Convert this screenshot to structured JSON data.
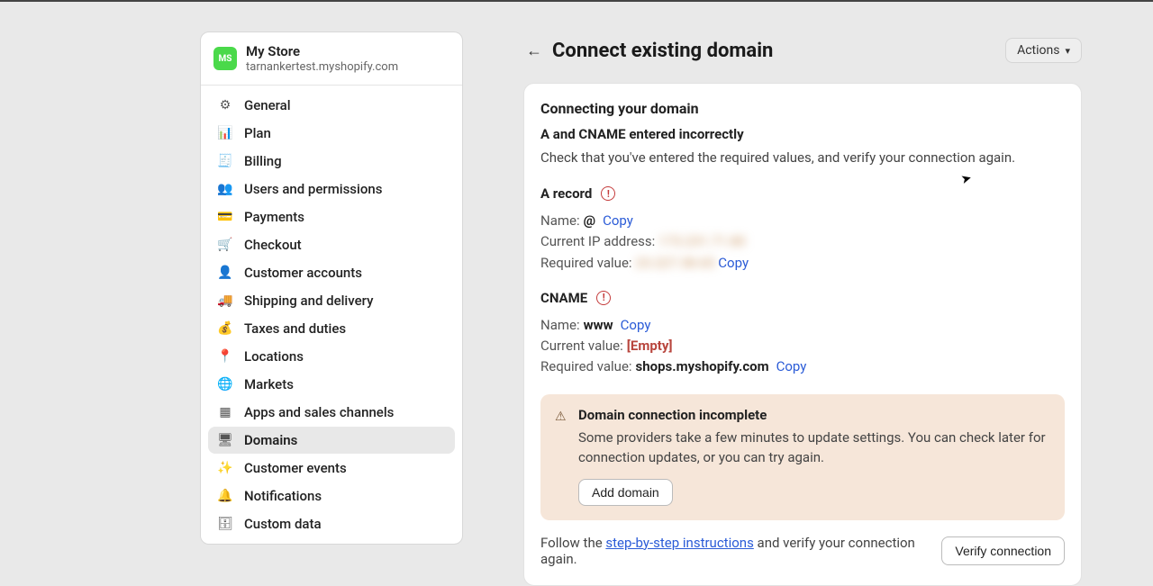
{
  "store": {
    "avatar_initials": "MS",
    "name": "My Store",
    "domain": "tarnankertest.myshopify.com"
  },
  "nav": {
    "general": "General",
    "plan": "Plan",
    "billing": "Billing",
    "users": "Users and permissions",
    "payments": "Payments",
    "checkout": "Checkout",
    "customer_accounts": "Customer accounts",
    "shipping": "Shipping and delivery",
    "taxes": "Taxes and duties",
    "locations": "Locations",
    "markets": "Markets",
    "apps": "Apps and sales channels",
    "domains": "Domains",
    "customer_events": "Customer events",
    "notifications": "Notifications",
    "custom_data": "Custom data"
  },
  "header": {
    "title": "Connect existing domain",
    "actions_label": "Actions"
  },
  "card": {
    "title": "Connecting your domain",
    "subtitle": "A and CNAME entered incorrectly",
    "desc": "Check that you've entered the required values, and verify your connection again."
  },
  "a_record": {
    "heading": "A record",
    "name_label": "Name:",
    "name_value": "@",
    "copy": "Copy",
    "current_label": "Current IP address:",
    "current_value": "173.231.71.80",
    "required_label": "Required value:",
    "required_value": "23.227.38.65",
    "copy2": "Copy"
  },
  "cname": {
    "heading": "CNAME",
    "name_label": "Name:",
    "name_value": "www",
    "copy": "Copy",
    "current_label": "Current value:",
    "current_value": "[Empty]",
    "required_label": "Required value:",
    "required_value": "shops.myshopify.com",
    "copy2": "Copy"
  },
  "alert": {
    "title": "Domain connection incomplete",
    "body": "Some providers take a few minutes to update settings. You can check later for connection updates, or you can try again.",
    "button": "Add domain"
  },
  "footer": {
    "prefix": "Follow the ",
    "link": "step-by-step instructions",
    "suffix": " and verify your connection again.",
    "verify": "Verify connection"
  }
}
